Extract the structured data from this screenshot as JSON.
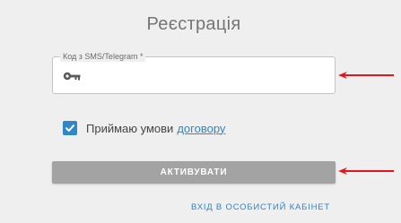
{
  "form": {
    "title": "Реєстрація",
    "code_field": {
      "label": "Код з SMS/Telegram *",
      "value": "",
      "icon": "key-icon"
    },
    "agree": {
      "checked": true,
      "label": "Приймаю умови",
      "link": "договору"
    },
    "activate_button": "АКТИВУВАТИ",
    "cabinet_link": "ВХІД В ОСОБИСТИЙ КАБІНЕТ"
  },
  "annotations": {
    "arrow_color": "#e8141c"
  },
  "colors": {
    "accent": "#2f86c8",
    "button_disabled": "#a3a3a3",
    "background": "#efefef"
  }
}
